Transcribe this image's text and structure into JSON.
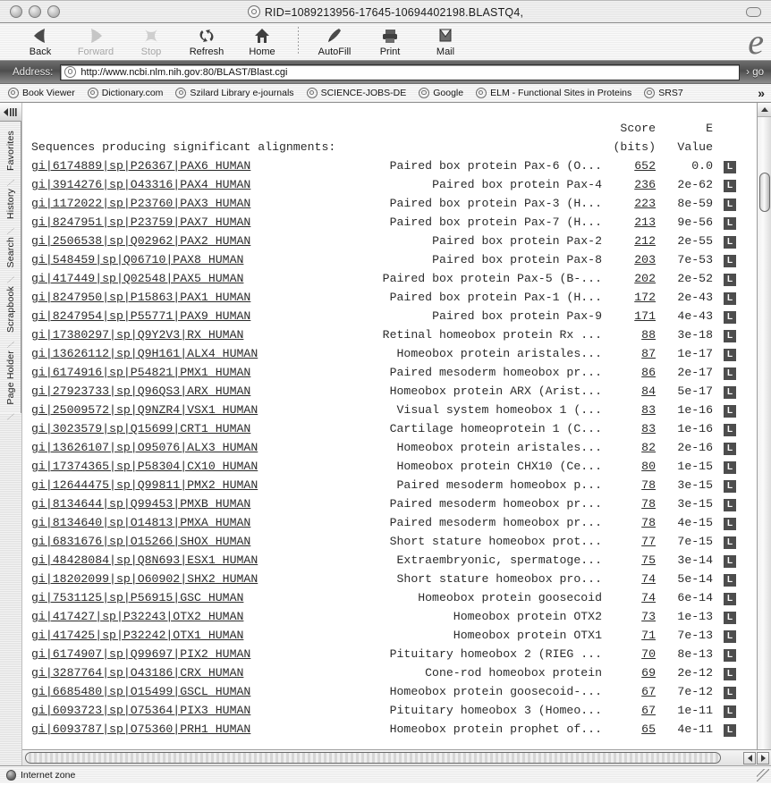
{
  "window": {
    "title": "RID=1089213956-17645-10694402198.BLASTQ4,",
    "title_icon": "at-sign-icon",
    "close_label": "",
    "minimize_label": "",
    "zoom_label": ""
  },
  "toolbar": {
    "items": [
      {
        "label": "Back",
        "icon": "back-arrow-icon",
        "enabled": true
      },
      {
        "label": "Forward",
        "icon": "forward-arrow-icon",
        "enabled": false
      },
      {
        "label": "Stop",
        "icon": "stop-x-icon",
        "enabled": false
      },
      {
        "label": "Refresh",
        "icon": "refresh-icon",
        "enabled": true
      },
      {
        "label": "Home",
        "icon": "home-icon",
        "enabled": true
      },
      {
        "label": "AutoFill",
        "icon": "autofill-pen-icon",
        "enabled": true
      },
      {
        "label": "Print",
        "icon": "printer-icon",
        "enabled": true
      },
      {
        "label": "Mail",
        "icon": "envelope-icon",
        "enabled": true
      }
    ],
    "browser_logo": "e"
  },
  "address_bar": {
    "label": "Address:",
    "url": "http://www.ncbi.nlm.nih.gov:80/BLAST/Blast.cgi",
    "placeholder": "http://",
    "go_label": "› go",
    "site_icon": "at-sign-icon"
  },
  "bookmarks": {
    "items": [
      "Book Viewer",
      "Dictionary.com",
      "Szilard Library e-journals",
      "SCIENCE-JOBS-DE",
      "Google",
      "ELM - Functional Sites in Proteins",
      "SRS7"
    ],
    "overflow_label": "»"
  },
  "sidebar": {
    "toggle_icon": "collapse-sidebar-icon",
    "tabs": [
      "Favorites",
      "History",
      "Search",
      "Scrapbook",
      "Page Holder"
    ]
  },
  "page": {
    "header": {
      "title": "Sequences producing significant alignments:",
      "score_line1": "Score",
      "score_line2": "(bits)",
      "evalue_line1": "E",
      "evalue_line2": "Value"
    },
    "link_badge": "L",
    "rows": [
      {
        "accession": "gi|6174889|sp|P26367|PAX6_HUMAN",
        "description": "Paired box protein Pax-6 (O...",
        "score": "652",
        "evalue": "0.0"
      },
      {
        "accession": "gi|3914276|sp|O43316|PAX4_HUMAN",
        "description": "Paired box protein Pax-4",
        "score": "236",
        "evalue": "2e-62"
      },
      {
        "accession": "gi|1172022|sp|P23760|PAX3_HUMAN",
        "description": "Paired box protein Pax-3 (H...",
        "score": "223",
        "evalue": "8e-59"
      },
      {
        "accession": "gi|8247951|sp|P23759|PAX7_HUMAN",
        "description": "Paired box protein Pax-7 (H...",
        "score": "213",
        "evalue": "9e-56"
      },
      {
        "accession": "gi|2506538|sp|Q02962|PAX2_HUMAN",
        "description": "Paired box protein Pax-2",
        "score": "212",
        "evalue": "2e-55"
      },
      {
        "accession": "gi|548459|sp|Q06710|PAX8_HUMAN",
        "description": "Paired box protein Pax-8",
        "score": "203",
        "evalue": "7e-53"
      },
      {
        "accession": "gi|417449|sp|Q02548|PAX5_HUMAN",
        "description": "Paired box protein Pax-5 (B-...",
        "score": "202",
        "evalue": "2e-52"
      },
      {
        "accession": "gi|8247950|sp|P15863|PAX1_HUMAN",
        "description": "Paired box protein Pax-1 (H...",
        "score": "172",
        "evalue": "2e-43"
      },
      {
        "accession": "gi|8247954|sp|P55771|PAX9_HUMAN",
        "description": "Paired box protein Pax-9",
        "score": "171",
        "evalue": "4e-43"
      },
      {
        "accession": "gi|17380297|sp|Q9Y2V3|RX_HUMAN",
        "description": "Retinal homeobox protein Rx ...",
        "score": "88",
        "evalue": "3e-18"
      },
      {
        "accession": "gi|13626112|sp|Q9H161|ALX4_HUMAN",
        "description": "Homeobox protein aristales...",
        "score": "87",
        "evalue": "1e-17"
      },
      {
        "accession": "gi|6174916|sp|P54821|PMX1_HUMAN",
        "description": "Paired mesoderm homeobox pr...",
        "score": "86",
        "evalue": "2e-17"
      },
      {
        "accession": "gi|27923733|sp|Q96QS3|ARX_HUMAN",
        "description": "Homeobox protein ARX (Arist...",
        "score": "84",
        "evalue": "5e-17"
      },
      {
        "accession": "gi|25009572|sp|Q9NZR4|VSX1_HUMAN",
        "description": "Visual system homeobox 1 (...",
        "score": "83",
        "evalue": "1e-16"
      },
      {
        "accession": "gi|3023579|sp|Q15699|CRT1_HUMAN",
        "description": "Cartilage homeoprotein 1 (C...",
        "score": "83",
        "evalue": "1e-16"
      },
      {
        "accession": "gi|13626107|sp|O95076|ALX3_HUMAN",
        "description": "Homeobox protein aristales...",
        "score": "82",
        "evalue": "2e-16"
      },
      {
        "accession": "gi|17374365|sp|P58304|CX10_HUMAN",
        "description": "Homeobox protein CHX10 (Ce...",
        "score": "80",
        "evalue": "1e-15"
      },
      {
        "accession": "gi|12644475|sp|Q99811|PMX2_HUMAN",
        "description": "Paired mesoderm homeobox p...",
        "score": "78",
        "evalue": "3e-15"
      },
      {
        "accession": "gi|8134644|sp|Q99453|PMXB_HUMAN",
        "description": "Paired mesoderm homeobox pr...",
        "score": "78",
        "evalue": "3e-15"
      },
      {
        "accession": "gi|8134640|sp|O14813|PMXA_HUMAN",
        "description": "Paired mesoderm homeobox pr...",
        "score": "78",
        "evalue": "4e-15"
      },
      {
        "accession": "gi|6831676|sp|O15266|SHOX_HUMAN",
        "description": "Short stature homeobox prot...",
        "score": "77",
        "evalue": "7e-15"
      },
      {
        "accession": "gi|48428084|sp|Q8N693|ESX1_HUMAN",
        "description": "Extraembryonic, spermatoge...",
        "score": "75",
        "evalue": "3e-14"
      },
      {
        "accession": "gi|18202099|sp|O60902|SHX2_HUMAN",
        "description": "Short stature homeobox pro...",
        "score": "74",
        "evalue": "5e-14"
      },
      {
        "accession": "gi|7531125|sp|P56915|GSC_HUMAN",
        "description": "Homeobox protein goosecoid",
        "score": "74",
        "evalue": "6e-14"
      },
      {
        "accession": "gi|417427|sp|P32243|OTX2_HUMAN",
        "description": "Homeobox protein OTX2",
        "score": "73",
        "evalue": "1e-13"
      },
      {
        "accession": "gi|417425|sp|P32242|OTX1_HUMAN",
        "description": "Homeobox protein OTX1",
        "score": "71",
        "evalue": "7e-13"
      },
      {
        "accession": "gi|6174907|sp|Q99697|PIX2_HUMAN",
        "description": "Pituitary homeobox 2 (RIEG ...",
        "score": "70",
        "evalue": "8e-13"
      },
      {
        "accession": "gi|3287764|sp|O43186|CRX_HUMAN",
        "description": "Cone-rod homeobox protein",
        "score": "69",
        "evalue": "2e-12"
      },
      {
        "accession": "gi|6685480|sp|O15499|GSCL_HUMAN",
        "description": "Homeobox protein goosecoid-...",
        "score": "67",
        "evalue": "7e-12"
      },
      {
        "accession": "gi|6093723|sp|O75364|PIX3_HUMAN",
        "description": "Pituitary homeobox 3 (Homeo...",
        "score": "67",
        "evalue": "1e-11"
      },
      {
        "accession": "gi|6093787|sp|O75360|PRH1_HUMAN",
        "description": "Homeobox protein prophet of...",
        "score": "65",
        "evalue": "4e-11"
      }
    ]
  },
  "status_bar": {
    "zone": "Internet zone",
    "zone_icon": "globe-icon"
  },
  "colors": {
    "badge_bg": "#4d4d4d",
    "badge_fg": "#ffffff",
    "text": "#2b2b2b",
    "chrome": "#ececec",
    "address_bar_bg": "#5a5a5a"
  }
}
